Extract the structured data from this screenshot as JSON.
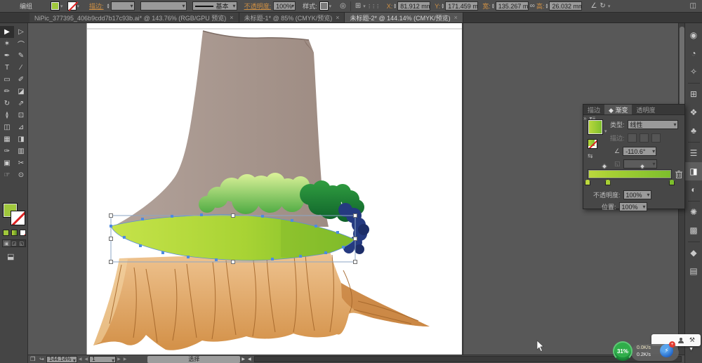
{
  "control_bar": {
    "context_label": "编组",
    "stroke_label": "描边:",
    "brush_value": "基本",
    "opacity_label": "不透明度:",
    "opacity_value": "100%",
    "style_label": "样式:",
    "x_label": "X:",
    "x_value": "81.912 mm",
    "y_label": "Y:",
    "y_value": "171.459 mm",
    "w_label": "宽:",
    "w_value": "135.267 mm",
    "h_label": "高:",
    "h_value": "26.032 mm",
    "icons": {
      "recolor": "◎",
      "align": "⊞",
      "transform_grid": "⋮⋮⋮",
      "link": "∞",
      "shear": "∠",
      "rotate": "↻",
      "workspace": "◫"
    }
  },
  "tabs": [
    {
      "name": "tab-nipic-document",
      "title": "NiPic_377395_406b9cdd7b17c93b.ai* @ 143.76% (RGB/GPU 预览)",
      "close": "×",
      "active": false
    },
    {
      "name": "tab-untitled-1",
      "title": "未标题-1* @ 85% (CMYK/预览)",
      "close": "×",
      "active": false
    },
    {
      "name": "tab-untitled-2",
      "title": "未标题-2* @ 144.14% (CMYK/预览)",
      "close": "×",
      "active": true
    }
  ],
  "toolbar": {
    "tools": [
      {
        "name": "selection-tool",
        "glyph": "▶",
        "active": true
      },
      {
        "name": "direct-selection-tool",
        "glyph": "▷"
      },
      {
        "name": "magic-wand-tool",
        "glyph": "✶"
      },
      {
        "name": "lasso-tool",
        "glyph": "⌒"
      },
      {
        "name": "pen-tool",
        "glyph": "✒"
      },
      {
        "name": "curvature-tool",
        "glyph": "✎"
      },
      {
        "name": "type-tool",
        "glyph": "T"
      },
      {
        "name": "line-segment-tool",
        "glyph": "∕"
      },
      {
        "name": "rectangle-tool",
        "glyph": "▭"
      },
      {
        "name": "paintbrush-tool",
        "glyph": "✐"
      },
      {
        "name": "pencil-tool",
        "glyph": "✏"
      },
      {
        "name": "eraser-tool",
        "glyph": "◪"
      },
      {
        "name": "rotate-tool",
        "glyph": "↻"
      },
      {
        "name": "scale-tool",
        "glyph": "⇗"
      },
      {
        "name": "width-tool",
        "glyph": "≬"
      },
      {
        "name": "free-transform-tool",
        "glyph": "⊡"
      },
      {
        "name": "shape-builder-tool",
        "glyph": "◫"
      },
      {
        "name": "perspective-grid-tool",
        "glyph": "⊿"
      },
      {
        "name": "mesh-tool",
        "glyph": "▦"
      },
      {
        "name": "gradient-tool",
        "glyph": "◨"
      },
      {
        "name": "eyedropper-tool",
        "glyph": "✑"
      },
      {
        "name": "graph-tool",
        "glyph": "▥"
      },
      {
        "name": "artboard-tool",
        "glyph": "▣"
      },
      {
        "name": "slice-tool",
        "glyph": "✂"
      },
      {
        "name": "hand-tool",
        "glyph": "☞"
      },
      {
        "name": "zoom-tool",
        "glyph": "⊙"
      }
    ],
    "draw_modes": [
      "▣",
      "◲",
      "◱"
    ],
    "screen_mode_glyph": "⬓"
  },
  "dock": {
    "icons": [
      {
        "name": "color-icon",
        "glyph": "◉"
      },
      {
        "name": "color-guide-icon",
        "glyph": "◔"
      },
      {
        "name": "pattern-options-icon",
        "glyph": "✧"
      },
      {
        "sep": true
      },
      {
        "name": "swatches-icon",
        "glyph": "⊞"
      },
      {
        "name": "brushes-icon",
        "glyph": "❖"
      },
      {
        "name": "symbols-icon",
        "glyph": "♣"
      },
      {
        "sep": true
      },
      {
        "name": "stroke-panel-icon",
        "glyph": "☰"
      },
      {
        "name": "gradient-panel-icon",
        "glyph": "◨",
        "active": true
      },
      {
        "name": "transparency-panel-icon",
        "glyph": "◐"
      },
      {
        "sep": true
      },
      {
        "name": "appearance-icon",
        "glyph": "✺"
      },
      {
        "name": "graphic-styles-icon",
        "glyph": "▩"
      },
      {
        "sep": true
      },
      {
        "name": "layers-icon",
        "glyph": "◆"
      },
      {
        "name": "artboards-icon",
        "glyph": "▤"
      }
    ]
  },
  "gradient_panel": {
    "tabs": [
      {
        "name": "gp-tab-stroke",
        "label": "描边"
      },
      {
        "name": "gp-tab-gradient",
        "label": "◆ 渐变",
        "active": true
      },
      {
        "name": "gp-tab-transparency",
        "label": "透明度"
      }
    ],
    "header_icons": {
      "expand": "»",
      "menu": "▾≡"
    },
    "type_label": "类型:",
    "type_value": "线性",
    "stroke_label": "描边:",
    "angle_value": "-110.6°",
    "reverse_glyph": "⇆",
    "angle_glyph": "∠",
    "ratio_glyph": "◱",
    "opacity_label": "不透明度:",
    "opacity_value": "100%",
    "location_label": "位置:",
    "location_value": "100%",
    "stops": [
      {
        "pos": 0,
        "color": "#bcd83e"
      },
      {
        "pos": 24,
        "color": "#a8d034"
      },
      {
        "pos": 100,
        "color": "#7cbe2c",
        "active": true
      }
    ],
    "midpoints": [
      {
        "pos": 20
      },
      {
        "pos": 65
      }
    ]
  },
  "status_bar": {
    "icon1": "❒",
    "icon2": "↪",
    "zoom_value": "144.14%",
    "nav_prev": "◀",
    "nav_next": "▶",
    "artboard_value": "1",
    "tool_hint": "选择",
    "scroll_right": "▶",
    "scroll_left": "◀"
  },
  "overlay_widget": {
    "progress": "31%",
    "speed_up": "0.0K/s",
    "speed_down": "0.2K/s",
    "wrench_glyph": "⚒",
    "blue_glyph": "⚡",
    "badge": "+"
  },
  "colors": {
    "fill_green": "#a0c83c",
    "gradient_left": "#bcd83e",
    "gradient_right": "#7cbe2c",
    "label_amber": "#cf9044",
    "trunk": "#a8968d",
    "bush_light": "#d8f097",
    "bush_dark": "#0b5b28",
    "bush_blue": "#253a80",
    "stump_light": "#eec28e",
    "stump_dark": "#d4924a",
    "selection_blue": "#4d8be0",
    "ui_bg": "#4d4d4d",
    "artboard_white": "#ffffff"
  }
}
